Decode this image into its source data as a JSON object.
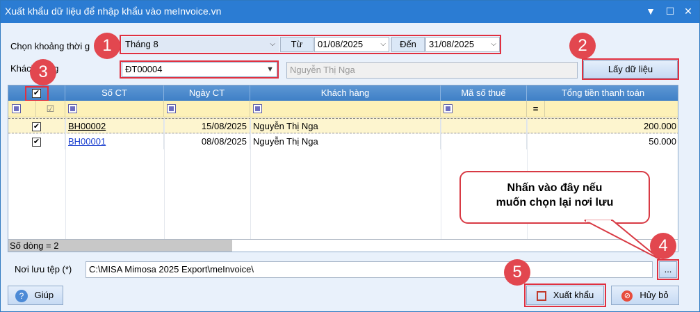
{
  "window": {
    "title": "Xuất khẩu dữ liệu để nhập khẩu vào meInvoice.vn",
    "controls": [
      "▼",
      "☐",
      "✕"
    ]
  },
  "filter": {
    "period_label": "Chọn khoảng thời g",
    "period_value": "Tháng 8",
    "from_label": "Từ",
    "from_value": "01/08/2025",
    "to_label": "Đến",
    "to_value": "31/08/2025",
    "customer_label": "Khách hàng",
    "customer_code": "ĐT00004",
    "customer_name": "Nguyễn Thị Nga",
    "fetch_button": "Lấy dữ liệu"
  },
  "table": {
    "columns": [
      "",
      "Số CT",
      "Ngày CT",
      "Khách hàng",
      "Mã số thuế",
      "Tổng tiền thanh toán"
    ],
    "filter_eq": "=",
    "rows": [
      {
        "checked": "✔",
        "so_ct": "BH00002",
        "ngay_ct": "15/08/2025",
        "khach_hang": "Nguyễn Thị Nga",
        "ma_so_thue": "",
        "tong_tien": "200.000"
      },
      {
        "checked": "✔",
        "so_ct": "BH00001",
        "ngay_ct": "08/08/2025",
        "khach_hang": "Nguyễn Thị Nga",
        "ma_so_thue": "",
        "tong_tien": "50.000"
      }
    ],
    "header_check": "✔",
    "row_count": "Số dòng = 2"
  },
  "save": {
    "label": "Nơi lưu tệp (*)",
    "path": "C:\\MISA Mimosa 2025 Export\\meInvoice\\",
    "browse": "..."
  },
  "buttons": {
    "help": "Giúp",
    "export": "Xuất khẩu",
    "cancel": "Hủy bỏ"
  },
  "annotations": {
    "n1": "1",
    "n2": "2",
    "n3": "3",
    "n4": "4",
    "n5": "5",
    "callout_line1": "Nhấn vào đây  nếu",
    "callout_line2": "muốn chọn lại nơi lưu"
  },
  "colors": {
    "titlebar": "#2b7cd3",
    "marker": "#e2474f",
    "link": "#1a3fcf"
  }
}
